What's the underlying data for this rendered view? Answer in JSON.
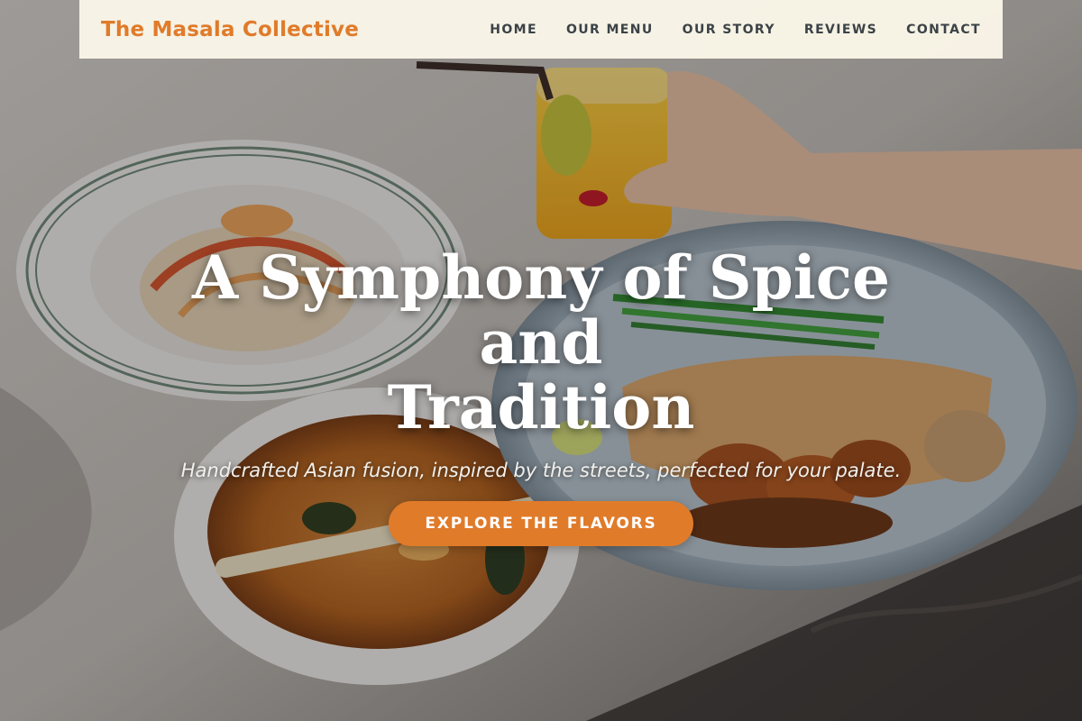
{
  "brand": {
    "name": "The Masala Collective",
    "color": "#e07b2a"
  },
  "nav": {
    "items": [
      {
        "label": "HOME"
      },
      {
        "label": "OUR MENU"
      },
      {
        "label": "OUR STORY"
      },
      {
        "label": "REVIEWS"
      },
      {
        "label": "CONTACT"
      }
    ]
  },
  "hero": {
    "headline_line1": "A Symphony of Spice and",
    "headline_line2": "Tradition",
    "subheadline": "Handcrafted Asian fusion, inspired by the streets, perfected for your palate.",
    "cta_label": "EXPLORE THE FLAVORS",
    "cta_color": "#e07b2a"
  }
}
